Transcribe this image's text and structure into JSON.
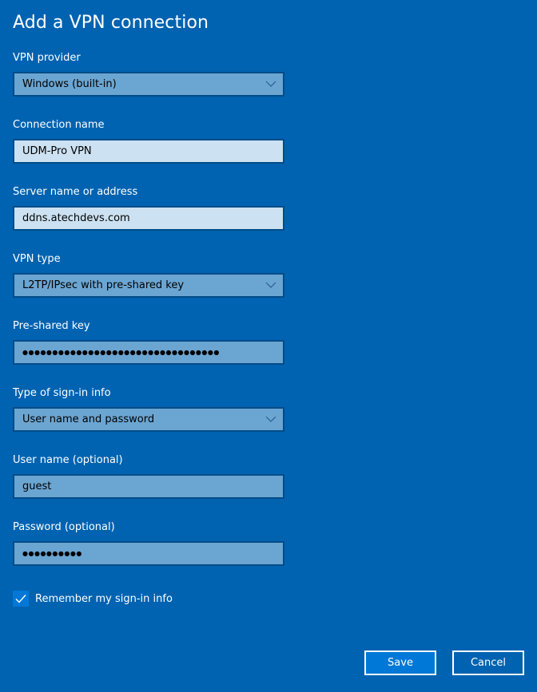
{
  "page": {
    "title": "Add a VPN connection"
  },
  "form": {
    "vpn_provider": {
      "label": "VPN provider",
      "value": "Windows (built-in)",
      "icon": "chevron-down-icon"
    },
    "connection_name": {
      "label": "Connection name",
      "value": "UDM-Pro VPN"
    },
    "server": {
      "label": "Server name or address",
      "value": "ddns.atechdevs.com"
    },
    "vpn_type": {
      "label": "VPN type",
      "value": "L2TP/IPsec with pre-shared key",
      "icon": "chevron-down-icon"
    },
    "pre_shared_key": {
      "label": "Pre-shared key",
      "value": "●●●●●●●●●●●●●●●●●●●●●●●●●●●●●●●●●"
    },
    "sign_in_type": {
      "label": "Type of sign-in info",
      "value": "User name and password",
      "icon": "chevron-down-icon"
    },
    "username": {
      "label": "User name (optional)",
      "value": "guest"
    },
    "password": {
      "label": "Password (optional)",
      "value": "●●●●●●●●●●"
    },
    "remember": {
      "label": "Remember my sign-in info",
      "checked": true,
      "icon": "checkmark-icon"
    }
  },
  "actions": {
    "save_label": "Save",
    "cancel_label": "Cancel"
  },
  "colors": {
    "background": "#0063b1",
    "accent": "#0078d7",
    "field_fill": "#6ba5d2",
    "field_fill_light": "#cce1f1",
    "field_border": "#004c87"
  }
}
